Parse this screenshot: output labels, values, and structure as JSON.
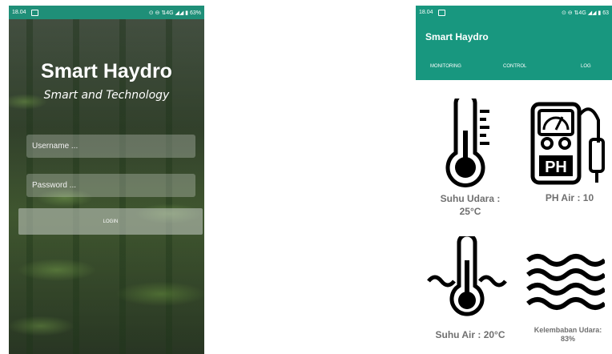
{
  "login_screen": {
    "status_bar": {
      "time": "18.04",
      "right_indicators": "⊙ ⊖ ⇅4G ◢◢ ▮ 63%"
    },
    "title": "Smart Haydro",
    "subtitle": "Smart and Technology",
    "username_placeholder": "Username ...",
    "password_placeholder": "Password ...",
    "login_button": "LOGIN"
  },
  "monitor_screen": {
    "status_bar": {
      "time": "18.04",
      "right_indicators": "⊙ ⊖ ⇅4G ◢◢ ▮ 63"
    },
    "app_title": "Smart Haydro",
    "tabs": [
      "MONITORING",
      "CONTROL",
      "LOG"
    ],
    "sensors": {
      "air_temp": {
        "label_line1": "Suhu Udara :",
        "label_line2": "25°C",
        "icon": "thermometer-icon"
      },
      "ph": {
        "label": "PH Air :  10",
        "icon": "ph-meter-icon"
      },
      "water_temp": {
        "label": "Suhu Air  :  20°C",
        "icon": "water-thermometer-icon"
      },
      "humidity": {
        "label_line1": "Kelembaban Udara:",
        "label_line2": "83%",
        "icon": "waves-icon"
      }
    },
    "colors": {
      "primary": "#18977f",
      "label_gray": "#707070"
    }
  }
}
